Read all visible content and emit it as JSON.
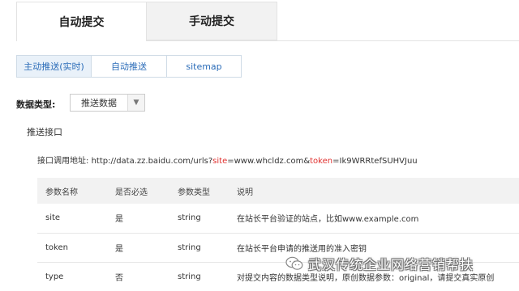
{
  "top_tabs": [
    {
      "label": "自动提交",
      "active": true
    },
    {
      "label": "手动提交",
      "active": false
    }
  ],
  "sub_tabs": [
    {
      "label": "主动推送(实时)",
      "active": true
    },
    {
      "label": "自动推送",
      "active": false
    },
    {
      "label": "sitemap",
      "active": false
    }
  ],
  "data_type": {
    "label": "数据类型:",
    "selected": "推送数据",
    "arrow_icon": "triangle-down-icon"
  },
  "interface": {
    "section_title": "推送接口",
    "url_label": "接口调用地址:",
    "url_parts": [
      {
        "text": "http://data.zz.baidu.com/urls?",
        "highlight": false
      },
      {
        "text": "site",
        "highlight": true
      },
      {
        "text": "=www.whcldz.com&",
        "highlight": false
      },
      {
        "text": "token",
        "highlight": true
      },
      {
        "text": "=Ik9WRRtefSUHVJuu",
        "highlight": false
      }
    ],
    "highlight_color": "#e0302e"
  },
  "params_table": {
    "headers": [
      "参数名称",
      "是否必选",
      "参数类型",
      "说明"
    ],
    "rows": [
      [
        "site",
        "是",
        "string",
        "在站长平台验证的站点，比如www.example.com"
      ],
      [
        "token",
        "是",
        "string",
        "在站长平台申请的推送用的准入密钥"
      ],
      [
        "type",
        "否",
        "string",
        "对提交内容的数据类型说明，原创数据参数：original，请提交真实原创"
      ]
    ]
  },
  "watermark": {
    "text": "武汉传统企业网络营销帮扶",
    "icon": "wechat-icon"
  }
}
